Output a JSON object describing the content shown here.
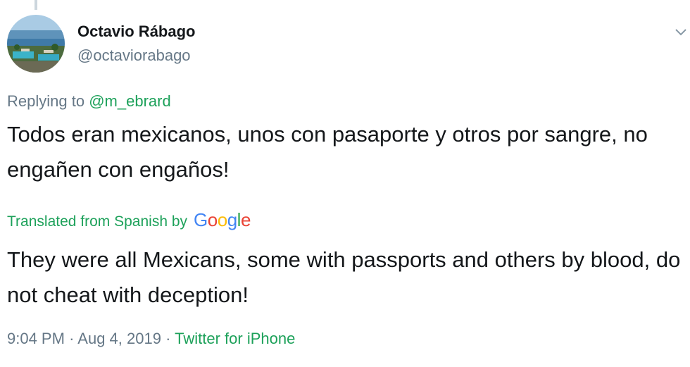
{
  "author": {
    "display_name": "Octavio Rábago",
    "handle": "@octaviorabago"
  },
  "reply": {
    "prefix": "Replying to",
    "mention": "@m_ebrard"
  },
  "tweet": {
    "original_text": "Todos eran mexicanos, unos con pasaporte y otros por sangre, no engañen con engaños!",
    "translated_label": "Translated from Spanish by",
    "translation_provider": [
      "G",
      "o",
      "o",
      "g",
      "l",
      "e"
    ],
    "translated_text": "They were all Mexicans, some with passports and others by blood, do not cheat with deception!"
  },
  "meta": {
    "time": "9:04 PM",
    "separator": "·",
    "date": "Aug 4, 2019",
    "source": "Twitter for iPhone"
  },
  "icons": {
    "menu": "chevron-down-icon",
    "avatar": "beach-resort-avatar"
  },
  "colors": {
    "accent_green": "#1da15a",
    "secondary_text": "#657786",
    "primary_text": "#14171a",
    "google_blue": "#4285f4",
    "google_red": "#ea4335",
    "google_yellow": "#fbbc05",
    "google_green": "#34a853"
  }
}
